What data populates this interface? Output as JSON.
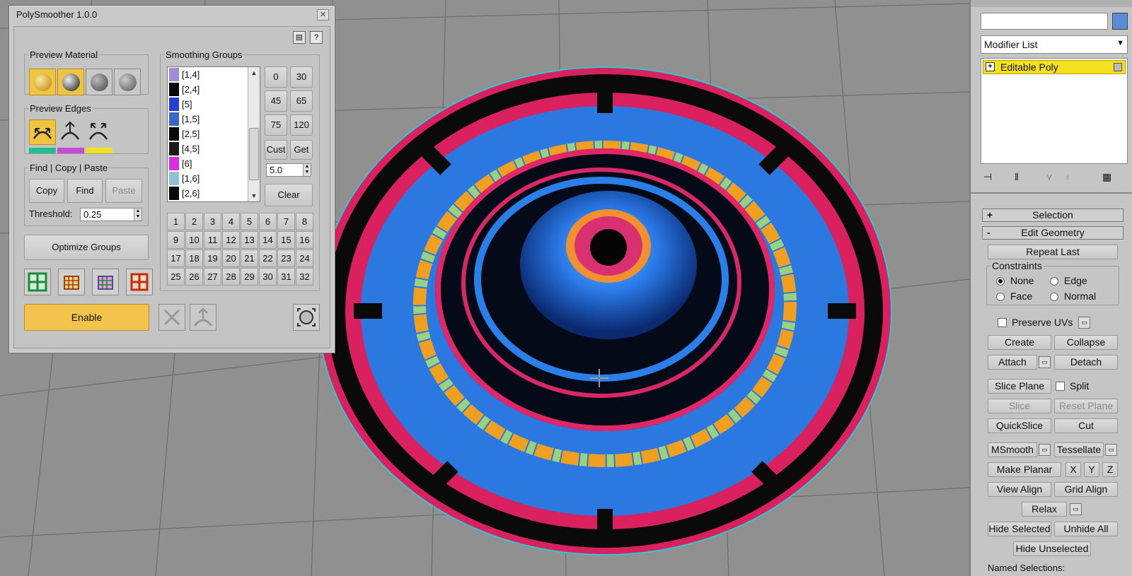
{
  "window": {
    "title": "PolySmoother 1.0.0",
    "close_icon": "close-icon",
    "top_icons": [
      "book-icon",
      "help-icon"
    ]
  },
  "preview_material": {
    "label": "Preview Material",
    "buttons": [
      "checker-material-icon",
      "smooth-sphere-icon",
      "flat-sphere-icon",
      "material-list-icon"
    ]
  },
  "preview_edges": {
    "label": "Preview Edges",
    "buttons": [
      "edges-split-icon",
      "edges-up-icon",
      "edges-spread-icon"
    ],
    "swatch_colors": [
      "#1fbf8f",
      "#c44bd8",
      "#f0e020"
    ]
  },
  "find_copy_paste": {
    "label": "Find | Copy | Paste",
    "copy": "Copy",
    "find": "Find",
    "paste": "Paste",
    "threshold_label": "Threshold:",
    "threshold_value": "0.25"
  },
  "optimize_label": "Optimize Groups",
  "enable_label": "Enable",
  "smoothing_groups": {
    "label": "Smoothing Groups",
    "items": [
      {
        "label": "[1,4]",
        "color": "#a08cd8"
      },
      {
        "label": "[2,4]",
        "color": "#0a0a0a"
      },
      {
        "label": "[5]",
        "color": "#2440d8"
      },
      {
        "label": "[1,5]",
        "color": "#3a66c8"
      },
      {
        "label": "[2,5]",
        "color": "#0a0a0a"
      },
      {
        "label": "[4,5]",
        "color": "#1a1a1a"
      },
      {
        "label": "[6]",
        "color": "#d830e0"
      },
      {
        "label": "[1,6]",
        "color": "#90c0d8"
      },
      {
        "label": "[2,6]",
        "color": "#0a0a0a"
      }
    ],
    "angles": [
      "0",
      "30",
      "45",
      "65",
      "75",
      "120"
    ],
    "cust": "Cust",
    "get": "Get",
    "angle_value": "5.0",
    "clear": "Clear",
    "numbers": [
      "1",
      "2",
      "3",
      "4",
      "5",
      "6",
      "7",
      "8",
      "9",
      "10",
      "11",
      "12",
      "13",
      "14",
      "15",
      "16",
      "17",
      "18",
      "19",
      "20",
      "21",
      "22",
      "23",
      "24",
      "25",
      "26",
      "27",
      "28",
      "29",
      "30",
      "31",
      "32"
    ]
  },
  "command_panel": {
    "modifier_list": "Modifier List",
    "stack_item": "Editable Poly",
    "rollout_selection": "Selection",
    "rollout_edit_geometry": "Edit Geometry",
    "repeat_last": "Repeat Last",
    "constraints_label": "Constraints",
    "constraint_none": "None",
    "constraint_edge": "Edge",
    "constraint_face": "Face",
    "constraint_normal": "Normal",
    "preserve_uvs": "Preserve UVs",
    "create": "Create",
    "collapse": "Collapse",
    "attach": "Attach",
    "detach": "Detach",
    "slice_plane": "Slice Plane",
    "split": "Split",
    "slice": "Slice",
    "reset_plane": "Reset Plane",
    "quickslice": "QuickSlice",
    "cut": "Cut",
    "msmooth": "MSmooth",
    "tessellate": "Tessellate",
    "make_planar": "Make Planar",
    "x": "X",
    "y": "Y",
    "z": "Z",
    "view_align": "View Align",
    "grid_align": "Grid Align",
    "relax": "Relax",
    "hide_selected": "Hide Selected",
    "unhide_all": "Unhide All",
    "hide_unselected": "Hide Unselected",
    "named_selections": "Named Selections:"
  },
  "accent_colors": {
    "highlight": "#f0c440",
    "stack_item_bg": "#f5e020"
  }
}
